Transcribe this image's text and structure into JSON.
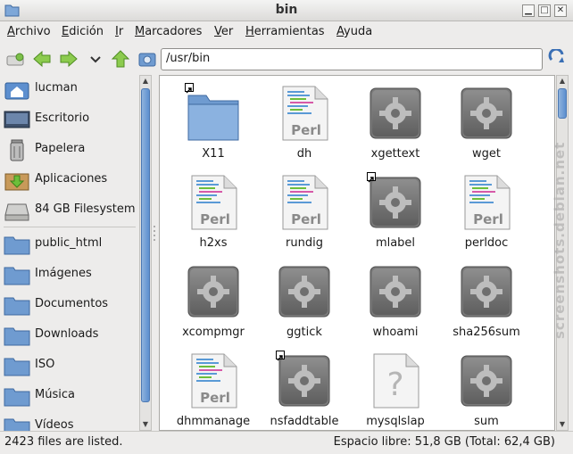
{
  "window": {
    "title": "bin"
  },
  "menu": [
    "Archivo",
    "Edición",
    "Ir",
    "Marcadores",
    "Ver",
    "Herramientas",
    "Ayuda"
  ],
  "menu_mnemonic": [
    "A",
    "E",
    "I",
    "M",
    "V",
    "H",
    "A"
  ],
  "location": {
    "value": "/usr/bin"
  },
  "sidebar": {
    "items": [
      {
        "label": "lucman",
        "icon": "home-icon"
      },
      {
        "label": "Escritorio",
        "icon": "desktop-icon"
      },
      {
        "label": "Papelera",
        "icon": "trash-icon"
      },
      {
        "label": "Aplicaciones",
        "icon": "applications-icon"
      },
      {
        "label": "84 GB Filesystem",
        "icon": "drive-icon"
      },
      {
        "label": "public_html",
        "icon": "folder-icon"
      },
      {
        "label": "Imágenes",
        "icon": "folder-icon"
      },
      {
        "label": "Documentos",
        "icon": "folder-icon"
      },
      {
        "label": "Downloads",
        "icon": "folder-icon"
      },
      {
        "label": "ISO",
        "icon": "folder-icon"
      },
      {
        "label": "Música",
        "icon": "folder-icon"
      },
      {
        "label": "Vídeos",
        "icon": "folder-icon"
      }
    ]
  },
  "files": [
    {
      "name": "X11",
      "type": "folder",
      "link": true
    },
    {
      "name": "dh",
      "type": "perl",
      "link": false
    },
    {
      "name": "xgettext",
      "type": "exec",
      "link": false
    },
    {
      "name": "wget",
      "type": "exec",
      "link": false
    },
    {
      "name": "h2xs",
      "type": "perl",
      "link": false
    },
    {
      "name": "rundig",
      "type": "script",
      "link": false
    },
    {
      "name": "mlabel",
      "type": "exec",
      "link": true
    },
    {
      "name": "perldoc",
      "type": "script",
      "link": false
    },
    {
      "name": "xcompmgr",
      "type": "exec",
      "link": false
    },
    {
      "name": "ggtick",
      "type": "exec",
      "link": false
    },
    {
      "name": "whoami",
      "type": "exec",
      "link": false
    },
    {
      "name": "sha256sum",
      "type": "exec",
      "link": false
    },
    {
      "name": "dhmmanage",
      "type": "perl",
      "link": false
    },
    {
      "name": "nsfaddtable",
      "type": "exec",
      "link": true
    },
    {
      "name": "mysqlslap",
      "type": "unknown",
      "link": false
    },
    {
      "name": "sum",
      "type": "exec",
      "link": false
    }
  ],
  "perl_label": "Perl",
  "status": {
    "count": "2423 files are listed.",
    "free": "Espacio libre: 51,8 GB (Total: 62,4 GB)"
  },
  "watermark": "screenshots.debian.net",
  "colors": {
    "folder": "#6f9bd0",
    "accent": "#5d8fcf",
    "arrow": "#5fa52a"
  }
}
